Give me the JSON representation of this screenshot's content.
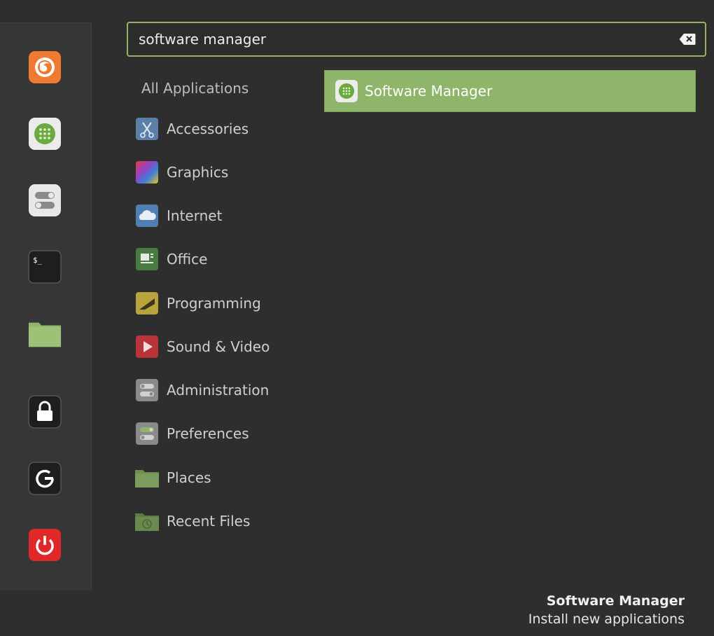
{
  "search": {
    "value": "software manager",
    "placeholder": ""
  },
  "favorites": [
    {
      "name": "firefox"
    },
    {
      "name": "software-manager"
    },
    {
      "name": "system-settings"
    },
    {
      "name": "terminal"
    },
    {
      "name": "files"
    },
    {
      "name": "lock-screen"
    },
    {
      "name": "logout"
    },
    {
      "name": "quit"
    }
  ],
  "categories": {
    "all": "All Applications",
    "items": [
      {
        "label": "Accessories",
        "icon": "scissors-icon"
      },
      {
        "label": "Graphics",
        "icon": "palette-icon"
      },
      {
        "label": "Internet",
        "icon": "cloud-icon"
      },
      {
        "label": "Office",
        "icon": "document-icon"
      },
      {
        "label": "Programming",
        "icon": "ruler-icon"
      },
      {
        "label": "Sound & Video",
        "icon": "play-icon"
      },
      {
        "label": "Administration",
        "icon": "toggles-icon"
      },
      {
        "label": "Preferences",
        "icon": "toggles-icon"
      },
      {
        "label": "Places",
        "icon": "folder-icon"
      },
      {
        "label": "Recent Files",
        "icon": "recent-folder-icon"
      }
    ]
  },
  "results": [
    {
      "label": "Software Manager",
      "icon": "software-manager-icon"
    }
  ],
  "description": {
    "title": "Software Manager",
    "subtitle": "Install new applications"
  },
  "colors": {
    "accent": "#8fb56a",
    "background": "#2e2e2e",
    "sidebar": "#363636"
  }
}
